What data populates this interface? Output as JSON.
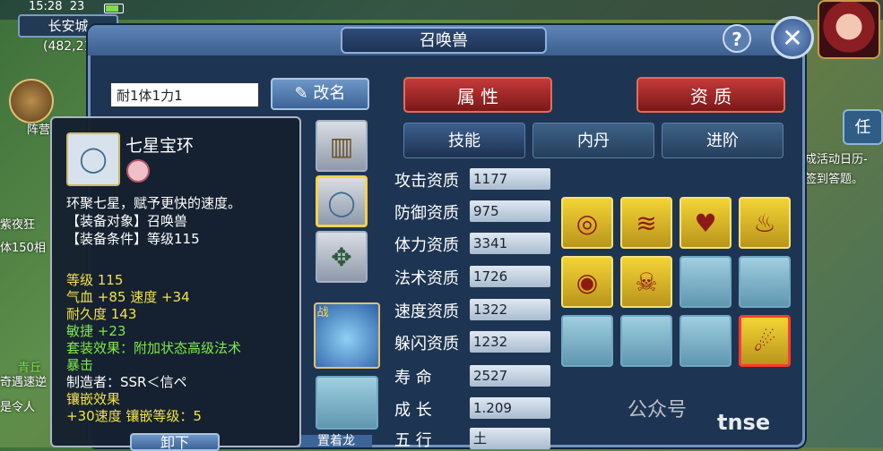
{
  "hud": {
    "time": "15:28",
    "time_suffix": "23",
    "map_name": "长安城",
    "coords": "(482,21",
    "left_labels": [
      "阵营",
      "紫夜狂",
      "体150相",
      "青丘",
      "奇遇速逆",
      "是令人"
    ],
    "right_tab": "任",
    "right_notice": [
      "成活动日历-",
      "签到答题。"
    ]
  },
  "window": {
    "title": "召唤兽",
    "help_label": "?",
    "close_label": "✕"
  },
  "pet": {
    "name_value": "耐1体1力1",
    "rename_label": "改名",
    "battle_tag": "战"
  },
  "tabs": {
    "attr": "属 性",
    "aptitude": "资 质",
    "skills": "技能",
    "neidan": "内丹",
    "advance": "进阶"
  },
  "stats": [
    {
      "label": "攻击资质",
      "value": "1177"
    },
    {
      "label": "防御资质",
      "value": "975"
    },
    {
      "label": "体力资质",
      "value": "3341"
    },
    {
      "label": "法术资质",
      "value": "1726"
    },
    {
      "label": "速度资质",
      "value": "1322"
    },
    {
      "label": "躲闪资质",
      "value": "1232"
    },
    {
      "label": "寿  命",
      "value": "2527"
    },
    {
      "label": "成  长",
      "value": "1.209"
    },
    {
      "label": "五  行",
      "value": "土"
    }
  ],
  "skills": [
    {
      "icon": "rings-icon",
      "filled": true
    },
    {
      "icon": "claw-icon",
      "filled": true
    },
    {
      "icon": "heart-icon",
      "filled": true
    },
    {
      "icon": "flame-icon",
      "filled": true
    },
    {
      "icon": "owl-icon",
      "filled": true
    },
    {
      "icon": "skeleton-icon",
      "filled": true
    },
    {
      "icon": "empty",
      "filled": false
    },
    {
      "icon": "empty",
      "filled": false
    },
    {
      "icon": "empty",
      "filled": false
    },
    {
      "icon": "empty",
      "filled": false
    },
    {
      "icon": "empty",
      "filled": false
    },
    {
      "icon": "meteor-icon",
      "filled": true
    }
  ],
  "tooltip": {
    "name": "七星宝环",
    "desc": "环聚七星，赋予更快的速度。",
    "target": "【装备对象】召唤兽",
    "condition": "【装备条件】等级115",
    "level": "等级 115",
    "hp_speed": "气血 +85 速度 +34",
    "durability": "耐久度 143",
    "agility": "敏捷 +23",
    "set_effect_1": "套装效果：附加状态高级法术",
    "set_effect_2": "暴击",
    "maker": "制造者：SSR＜信ペ",
    "inlay_title": "镶嵌效果",
    "inlay_detail": "+30速度 镶嵌等级：5",
    "unequip_label": "卸下"
  },
  "footer": {
    "set_label": "置着龙",
    "watermark_1": "公众号",
    "watermark_2": "tnse"
  }
}
